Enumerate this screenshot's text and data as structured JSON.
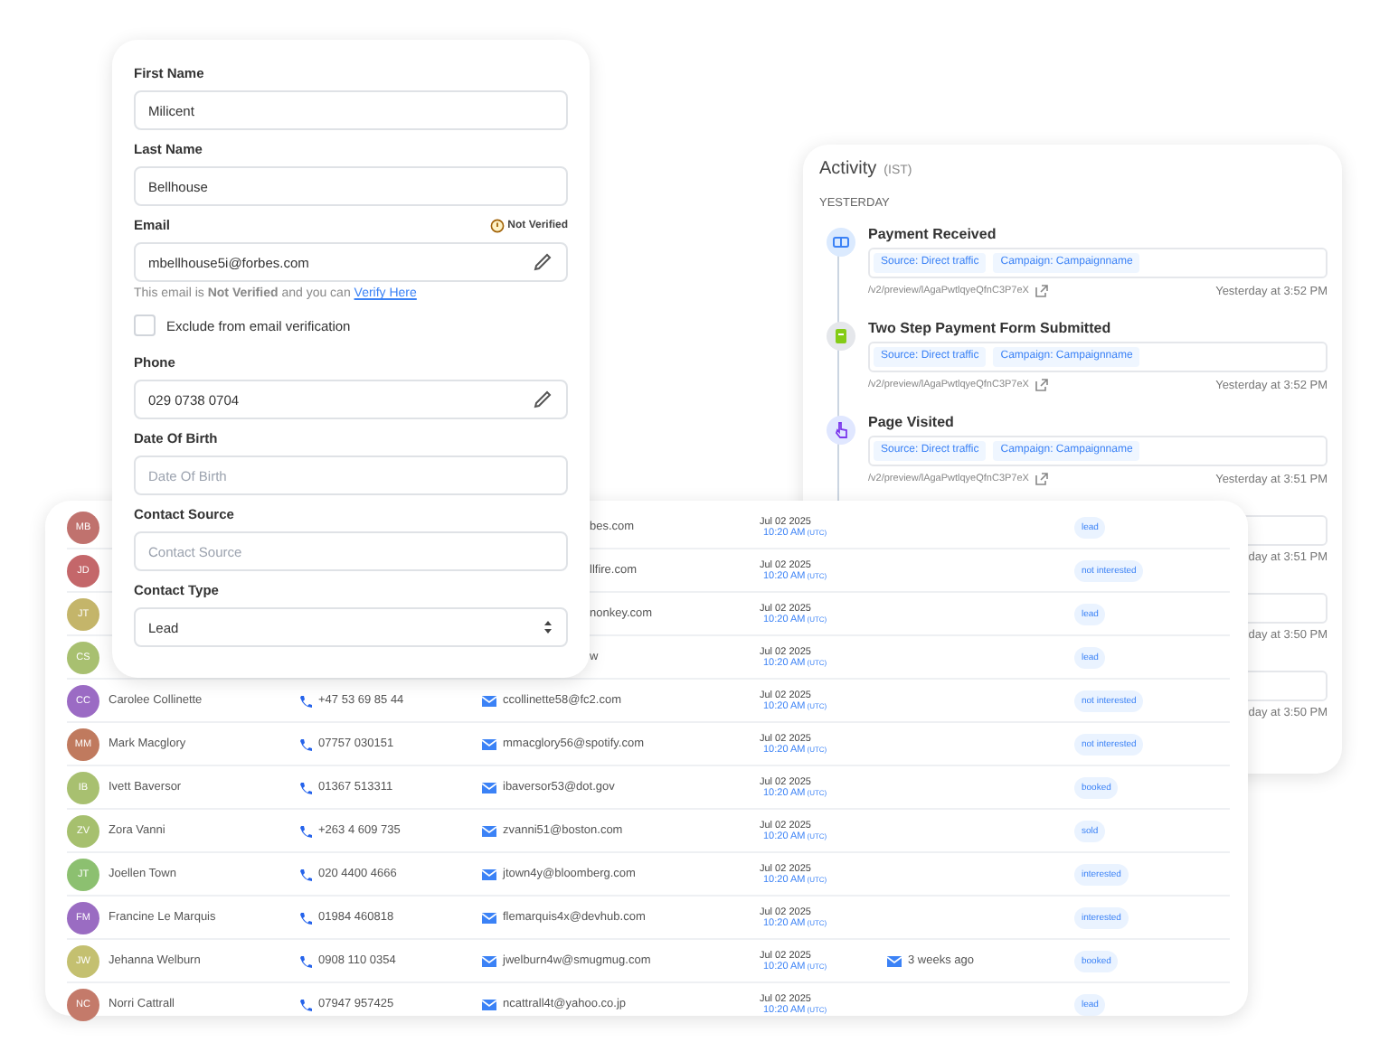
{
  "activity": {
    "title": "Activity",
    "zone": "(IST)",
    "day": "YESTERDAY",
    "events": [
      {
        "kind": "full",
        "title": "Payment Received",
        "tags": [
          "Source: Direct traffic",
          "Campaign: Campaignname"
        ],
        "url": "/v2/preview/lAgaPwtlqyeQfnC3P7eX",
        "time": "Yesterday at 3:52 PM"
      },
      {
        "kind": "full",
        "title": "Two Step Payment Form Submitted",
        "tags": [
          "Source: Direct traffic",
          "Campaign: Campaignname"
        ],
        "url": "/v2/preview/lAgaPwtlqyeQfnC3P7eX",
        "time": "Yesterday at 3:52 PM"
      },
      {
        "kind": "full",
        "title": "Page Visited",
        "tags": [
          "Source: Direct traffic",
          "Campaign: Campaignname"
        ],
        "url": "/v2/preview/lAgaPwtlqyeQfnC3P7eX",
        "time": "Yesterday at 3:51 PM"
      },
      {
        "kind": "partial",
        "time": "day at 3:51 PM"
      },
      {
        "kind": "partial",
        "time": "day at 3:50 PM"
      },
      {
        "kind": "partial",
        "time": "day at 3:50 PM"
      }
    ]
  },
  "contacts": {
    "rows": [
      {
        "kind": "covered",
        "initials": "MB",
        "color": "#c0726e",
        "email": "bes.com",
        "date": "Jul 02 2025",
        "time": "10:20 AM",
        "zone": "(UTC)",
        "status": "lead"
      },
      {
        "kind": "covered",
        "initials": "JD",
        "color": "#c4676a",
        "email": "llfire.com",
        "date": "Jul 02 2025",
        "time": "10:20 AM",
        "zone": "(UTC)",
        "status": "not interested"
      },
      {
        "kind": "covered",
        "initials": "JT",
        "color": "#c4b56a",
        "email": "nonkey.com",
        "date": "Jul 02 2025",
        "time": "10:20 AM",
        "zone": "(UTC)",
        "status": "lead"
      },
      {
        "kind": "covered",
        "initials": "CS",
        "color": "#a8c070",
        "email": "w",
        "date": "Jul 02 2025",
        "time": "10:20 AM",
        "zone": "(UTC)",
        "status": "lead"
      },
      {
        "kind": "full",
        "initials": "CC",
        "color": "#9b6bc4",
        "name": "Carolee Collinette",
        "phone": "+47 53 69 85 44",
        "email": "ccollinette58@fc2.com",
        "date": "Jul 02 2025",
        "time": "10:20 AM",
        "zone": "(UTC)",
        "status": "not interested"
      },
      {
        "kind": "full",
        "initials": "MM",
        "color": "#c07a5e",
        "name": "Mark Macglory",
        "phone": "07757 030151",
        "email": "mmacglory56@spotify.com",
        "date": "Jul 02 2025",
        "time": "10:20 AM",
        "zone": "(UTC)",
        "status": "not interested"
      },
      {
        "kind": "full",
        "initials": "IB",
        "color": "#a8c070",
        "name": "Ivett Baversor",
        "phone": "01367 513311",
        "email": "ibaversor53@dot.gov",
        "date": "Jul 02 2025",
        "time": "10:20 AM",
        "zone": "(UTC)",
        "status": "booked"
      },
      {
        "kind": "full",
        "initials": "ZV",
        "color": "#a6c06e",
        "name": "Zora Vanni",
        "phone": "+263 4 609 735",
        "email": "zvanni51@boston.com",
        "date": "Jul 02 2025",
        "time": "10:20 AM",
        "zone": "(UTC)",
        "status": "sold"
      },
      {
        "kind": "full",
        "initials": "JT",
        "color": "#8cc070",
        "name": "Joellen Town",
        "phone": "020 4400 4666",
        "email": "jtown4y@bloomberg.com",
        "date": "Jul 02 2025",
        "time": "10:20 AM",
        "zone": "(UTC)",
        "status": "interested"
      },
      {
        "kind": "full",
        "initials": "FM",
        "color": "#9a6cc2",
        "name": "Francine Le Marquis",
        "phone": "01984 460818",
        "email": "flemarquis4x@devhub.com",
        "date": "Jul 02 2025",
        "time": "10:20 AM",
        "zone": "(UTC)",
        "status": "interested"
      },
      {
        "kind": "full",
        "initials": "JW",
        "color": "#c4c070",
        "name": "Jehanna Welburn",
        "phone": "0908 110 0354",
        "email": "jwelburn4w@smugmug.com",
        "date": "Jul 02 2025",
        "time": "10:20 AM",
        "zone": "(UTC)",
        "activity": "3 weeks ago",
        "status": "booked"
      },
      {
        "kind": "full",
        "initials": "NC",
        "color": "#c47a6a",
        "name": "Norri Cattrall",
        "phone": "07947 957425",
        "email": "ncattrall4t@yahoo.co.jp",
        "date": "Jul 02 2025",
        "time": "10:20 AM",
        "zone": "(UTC)",
        "status": "lead"
      }
    ]
  },
  "form": {
    "fields": [
      {
        "kind": "text",
        "label": "First Name",
        "value": "Milicent",
        "editable": false
      },
      {
        "kind": "text",
        "label": "Last Name",
        "value": "Bellhouse",
        "editable": false
      },
      {
        "kind": "email",
        "label": "Email",
        "badge": "Not Verified",
        "value": "mbellhouse5i@forbes.com",
        "editable": true,
        "help": "This email is **Not Verified** and you can",
        "link": "Verify Here"
      },
      {
        "kind": "checkbox",
        "label": "Exclude from email verification",
        "checked": false
      },
      {
        "kind": "text",
        "label": "Phone",
        "value": "029 0738 0704",
        "editable": true
      },
      {
        "kind": "text",
        "label": "Date Of Birth",
        "placeholder": "Date Of Birth",
        "editable": false
      },
      {
        "kind": "text",
        "label": "Contact Source",
        "placeholder": "Contact Source",
        "editable": false
      },
      {
        "kind": "select",
        "label": "Contact Type",
        "value": "Lead"
      }
    ]
  }
}
